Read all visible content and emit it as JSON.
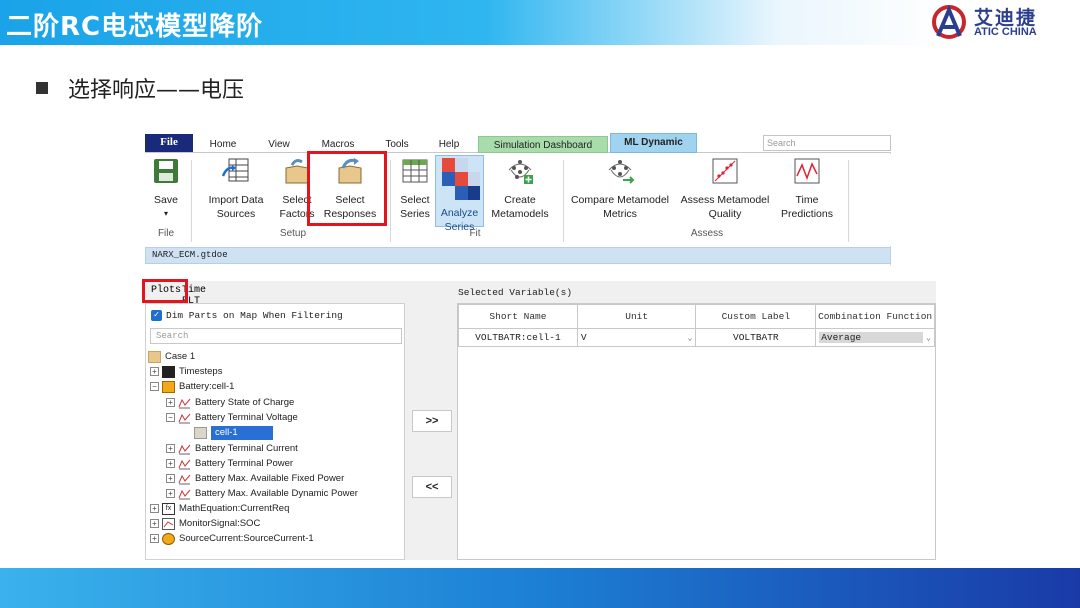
{
  "slide": {
    "title": "二阶RC电芯模型降阶",
    "logo_cn": "艾迪捷",
    "logo_en": "ATIC CHINA",
    "bullet": "选择响应——电压"
  },
  "ribbon": {
    "tabs": [
      "File",
      "Home",
      "View",
      "Macros",
      "Tools",
      "Help",
      "Simulation Dashboard",
      "ML Dynamic"
    ],
    "search_placeholder": "Search",
    "buttons": {
      "save": "Save",
      "import": "Import Data Sources",
      "select_factors": "Select Factors",
      "select_responses": "Select Responses",
      "select_series": "Select Series",
      "analyze_series": "Analyze Series",
      "create_metamodels": "Create Metamodels",
      "compare": "Compare Metamodel Metrics",
      "assess": "Assess Metamodel Quality",
      "time_predictions": "Time Predictions"
    },
    "groups": {
      "file": "File",
      "setup": "Setup",
      "fit": "Fit",
      "assess": "Assess"
    },
    "path": "NARX_ECM.gtdoe"
  },
  "left_panel": {
    "tabs": [
      "Plots",
      "Time RLT"
    ],
    "dim_parts": "Dim Parts on Map When Filtering",
    "search_placeholder": "Search",
    "tree": [
      "Case 1",
      "Timesteps",
      "Battery:cell-1",
      "Battery State of Charge",
      "Battery Terminal Voltage",
      "cell-1",
      "Battery Terminal Current",
      "Battery Terminal Power",
      "Battery Max. Available Fixed Power",
      "Battery Max. Available Dynamic Power",
      "MathEquation:CurrentReq",
      "MonitorSignal:SOC",
      "SourceCurrent:SourceCurrent-1"
    ]
  },
  "controls": {
    "add": ">>",
    "remove": "<<"
  },
  "right_panel": {
    "title": "Selected Variable(s)",
    "columns": [
      "Short Name",
      "Unit",
      "Custom Label",
      "Combination Function"
    ],
    "rows": [
      {
        "short_name": "VOLTBATR:cell-1",
        "unit": "V",
        "custom_label": "VOLTBATR",
        "combination": "Average"
      }
    ]
  },
  "colors": {
    "header_blue": "#1aa3e8",
    "highlight_red": "#e3141e",
    "file_tab": "#1a2a7a",
    "sim_tab": "#a9dcab",
    "ml_tab": "#9fd3ef",
    "selection_blue": "#2a6fd6"
  }
}
